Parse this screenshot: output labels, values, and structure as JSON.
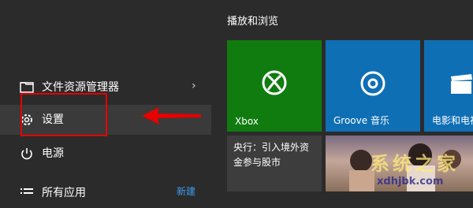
{
  "start_menu": {
    "items": [
      {
        "label": "文件资源管理器",
        "icon": "folder-icon",
        "has_arrow": true
      },
      {
        "label": "设置",
        "icon": "gear-icon"
      },
      {
        "label": "电源",
        "icon": "power-icon"
      },
      {
        "label": "所有应用",
        "icon": "list-icon",
        "badge": "新建"
      }
    ],
    "explorer_arrow": "›"
  },
  "tiles": {
    "group_title": "播放和浏览",
    "xbox_label": "Xbox",
    "groove_label": "Groove 音乐",
    "movies_label": "电影和电视",
    "news_text": "央行：引入境外资金参与股市"
  },
  "watermark": {
    "brand": "系统之家",
    "url": "xdhjbk.com"
  },
  "colors": {
    "highlight": "#e60000",
    "xbox_green": "#107c10",
    "tile_blue": "#0f6fb4",
    "new_badge": "#3e9cf0"
  }
}
